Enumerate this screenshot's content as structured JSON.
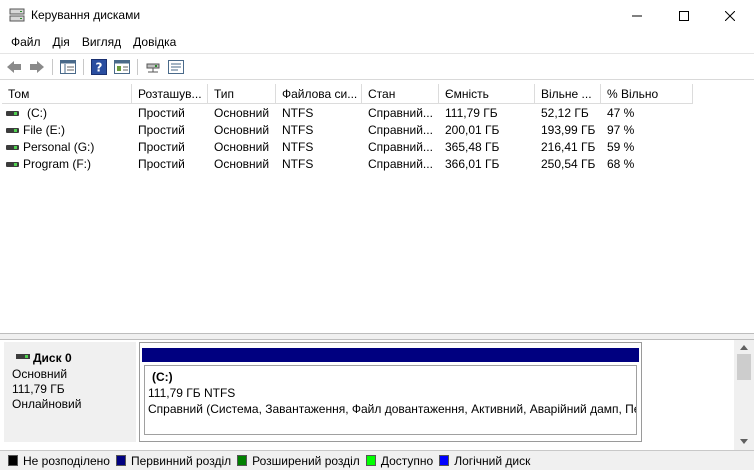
{
  "window": {
    "title": "Керування дисками"
  },
  "menu": [
    "Файл",
    "Дія",
    "Вигляд",
    "Довідка"
  ],
  "toolbar": {
    "icons": [
      "back-arrow-icon",
      "forward-arrow-icon",
      "list-view-icon",
      "help-icon",
      "properties-icon",
      "connect-drive-icon",
      "settings-icon"
    ]
  },
  "volume_table": {
    "columns": [
      "Том",
      "Розташув...",
      "Тип",
      "Файлова си...",
      "Стан",
      "Ємність",
      "Вільне ...",
      "% Вільно"
    ],
    "rows": [
      {
        "name": "(C:)",
        "layout": "Простий",
        "type": "Основний",
        "fs": "NTFS",
        "status": "Справний...",
        "capacity": "111,79 ГБ",
        "free": "52,12 ГБ",
        "pct": "47 %"
      },
      {
        "name": "File (E:)",
        "layout": "Простий",
        "type": "Основний",
        "fs": "NTFS",
        "status": "Справний...",
        "capacity": "200,01 ГБ",
        "free": "193,99 ГБ",
        "pct": "97 %"
      },
      {
        "name": "Personal (G:)",
        "layout": "Простий",
        "type": "Основний",
        "fs": "NTFS",
        "status": "Справний...",
        "capacity": "365,48 ГБ",
        "free": "216,41 ГБ",
        "pct": "59 %"
      },
      {
        "name": "Program (F:)",
        "layout": "Простий",
        "type": "Основний",
        "fs": "NTFS",
        "status": "Справний...",
        "capacity": "366,01 ГБ",
        "free": "250,54 ГБ",
        "pct": "68 %"
      }
    ]
  },
  "disk": {
    "name": "Диск 0",
    "type": "Основний",
    "size": "111,79 ГБ",
    "state": "Онлайновий",
    "partition": {
      "title": "(C:)",
      "size_fs": "111,79 ГБ NTFS",
      "status": "Справний (Система, Завантаження, Файл довантаження, Активний, Аварійний дамп, Пе"
    }
  },
  "legend": [
    {
      "label": "Не розподілено",
      "color": "#000000"
    },
    {
      "label": "Первинний розділ",
      "color": "#000080"
    },
    {
      "label": "Розширений розділ",
      "color": "#008000"
    },
    {
      "label": "Доступно",
      "color": "#00ff00"
    },
    {
      "label": "Логічний диск",
      "color": "#0000ff"
    }
  ],
  "colors": {
    "primary_partition_bar": "#000080",
    "disk_panel_bg": "#f0f0f0"
  }
}
